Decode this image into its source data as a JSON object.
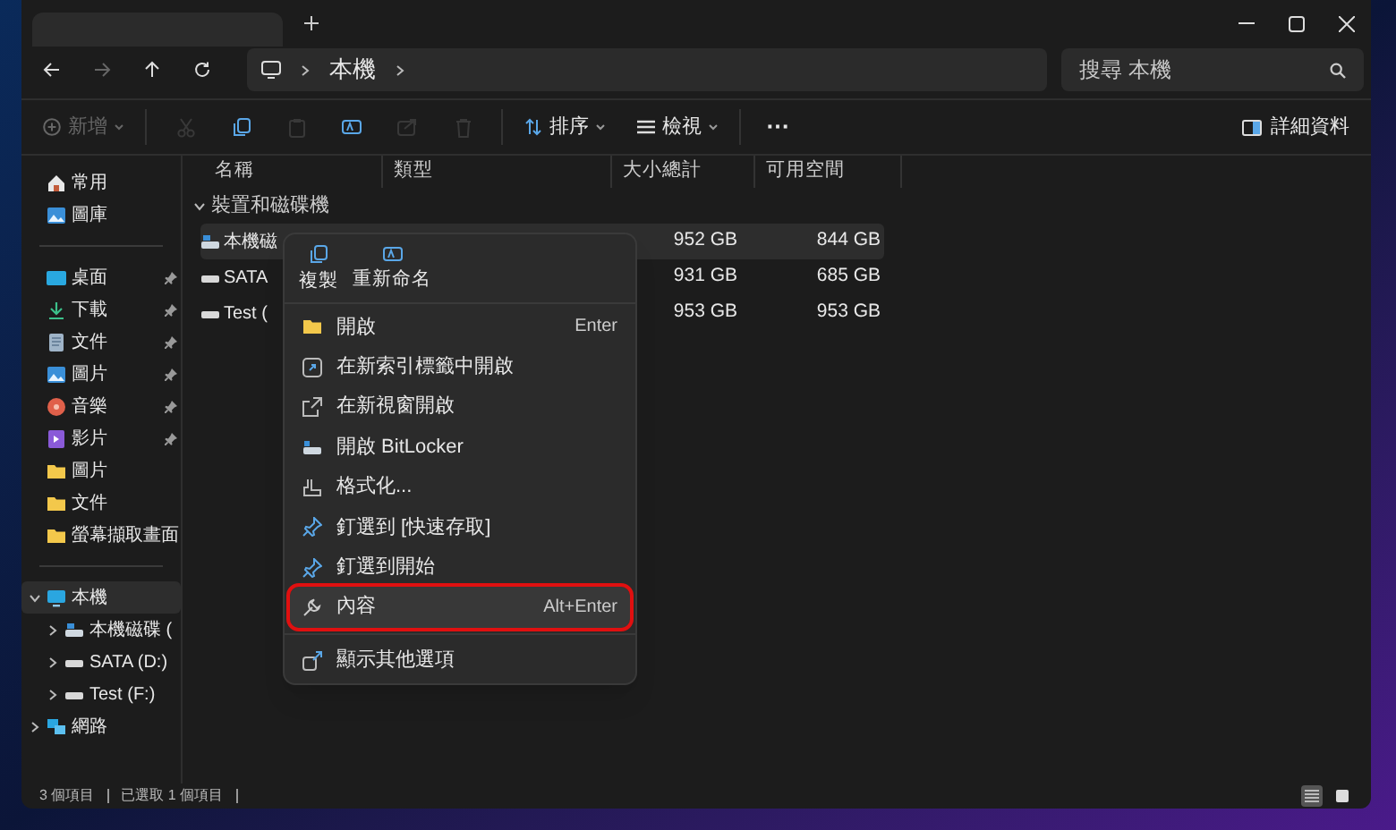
{
  "tabs": [
    {
      "selected": true
    }
  ],
  "address": {
    "path": [
      "本機"
    ]
  },
  "search": {
    "placeholder": "搜尋 本機"
  },
  "nav": [
    {
      "kind": "back",
      "disabled": false
    },
    {
      "kind": "forward",
      "disabled": true
    },
    {
      "kind": "up",
      "disabled": false
    },
    {
      "kind": "refresh",
      "disabled": false
    }
  ],
  "toolbar": {
    "new": {
      "label": "新增",
      "disabled": true
    },
    "actions": [
      {
        "kind": "cut",
        "disabled": true
      },
      {
        "kind": "copy",
        "disabled": false
      },
      {
        "kind": "paste",
        "disabled": true
      },
      {
        "kind": "rename",
        "disabled": false
      },
      {
        "kind": "share",
        "disabled": true
      },
      {
        "kind": "delete",
        "disabled": true
      }
    ],
    "sort": "排序",
    "view": "檢視",
    "more": "⋯",
    "details": "詳細資料"
  },
  "sidebar": {
    "groups": [
      [
        {
          "label": "常用",
          "kind": "home",
          "pinned": false
        },
        {
          "label": "圖庫",
          "kind": "gallery",
          "pinned": false
        }
      ],
      [
        {
          "label": "桌面",
          "kind": "desktop",
          "pinned": true
        },
        {
          "label": "下載",
          "kind": "download",
          "pinned": true
        },
        {
          "label": "文件",
          "kind": "documents",
          "pinned": true
        },
        {
          "label": "圖片",
          "kind": "pictures",
          "pinned": true
        },
        {
          "label": "音樂",
          "kind": "music",
          "pinned": true
        },
        {
          "label": "影片",
          "kind": "videos",
          "pinned": true
        },
        {
          "label": "圖片",
          "kind": "folder",
          "pinned": false
        },
        {
          "label": "文件",
          "kind": "folder",
          "pinned": false
        },
        {
          "label": "螢幕擷取畫面",
          "kind": "folder",
          "pinned": false
        }
      ]
    ],
    "tree": [
      {
        "label": "本機",
        "kind": "pc",
        "selected": true,
        "expanded": true,
        "children": [
          {
            "label": "本機磁碟 (",
            "kind": "sysdrive",
            "selected": false,
            "expanded": false
          },
          {
            "label": "SATA (D:)",
            "kind": "drive",
            "selected": false,
            "expanded": false
          },
          {
            "label": "Test (F:)",
            "kind": "drive",
            "selected": false,
            "expanded": false
          }
        ]
      },
      {
        "label": "網路",
        "kind": "network",
        "selected": false,
        "expanded": false
      }
    ]
  },
  "table": {
    "columns": [
      "名稱",
      "類型",
      "大小總計",
      "可用空間"
    ],
    "group": "裝置和磁碟機",
    "rows": [
      {
        "name": "本機磁",
        "kind": "sysdrive",
        "total": "952 GB",
        "free": "844 GB",
        "selected": true
      },
      {
        "name": "SATA",
        "kind": "drive",
        "total": "931 GB",
        "free": "685 GB",
        "selected": false
      },
      {
        "name": "Test (",
        "kind": "drive",
        "total": "953 GB",
        "free": "953 GB",
        "selected": false
      }
    ]
  },
  "context_menu": {
    "actions": [
      {
        "label": "複製",
        "kind": "copy"
      },
      {
        "label": "重新命名",
        "kind": "rename"
      }
    ],
    "items": [
      {
        "label": "開啟",
        "shortcut": "Enter",
        "kind": "folder",
        "selected": false
      },
      {
        "label": "在新索引標籤中開啟",
        "kind": "newtab",
        "selected": false
      },
      {
        "label": "在新視窗開啟",
        "kind": "newwindow",
        "selected": false
      },
      {
        "label": "開啟 BitLocker",
        "kind": "bitlocker",
        "selected": false
      },
      {
        "label": "格式化...",
        "kind": "format",
        "selected": false
      },
      {
        "label": "釘選到 [快速存取]",
        "kind": "pin",
        "selected": false
      },
      {
        "label": "釘選到開始",
        "kind": "pin",
        "selected": false
      },
      {
        "label": "內容",
        "shortcut": "Alt+Enter",
        "kind": "properties",
        "selected": true
      },
      {
        "label": "顯示其他選項",
        "kind": "more",
        "selected": false,
        "separated": true
      }
    ]
  },
  "status_bar": {
    "items": [
      "3 個項目",
      "已選取 1 個項目"
    ],
    "views": [
      {
        "kind": "details",
        "selected": true
      },
      {
        "kind": "tiles",
        "selected": false
      }
    ]
  }
}
